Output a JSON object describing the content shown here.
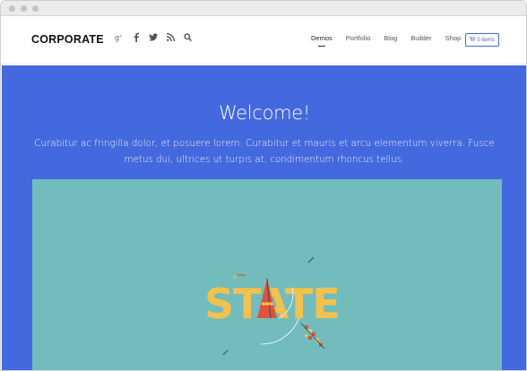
{
  "header": {
    "logo": "CORPORATE",
    "social_icons": [
      "google-plus-icon",
      "facebook-icon",
      "twitter-icon",
      "rss-icon",
      "search-icon"
    ],
    "nav": [
      {
        "label": "Demos",
        "active": true
      },
      {
        "label": "Portfolio",
        "active": false
      },
      {
        "label": "Blog",
        "active": false
      },
      {
        "label": "Builder",
        "active": false
      },
      {
        "label": "Shop",
        "active": false
      }
    ],
    "cart_label": "0 items"
  },
  "hero": {
    "title": "Welcome!",
    "text": "Curabitur ac fringilla dolor, et posuere lorem. Curabitur et mauris et arcu elementum viverra. Fusce metus dui, ultrices ut turpis at, condimentum rhoncus tellus.",
    "artwork_word": "STATE"
  },
  "colors": {
    "hero_bg": "#4468dd",
    "showcase_bg": "#72bcbd",
    "accent": "#4a68d6",
    "art_yellow": "#f2c14e",
    "art_red": "#e0523b"
  }
}
